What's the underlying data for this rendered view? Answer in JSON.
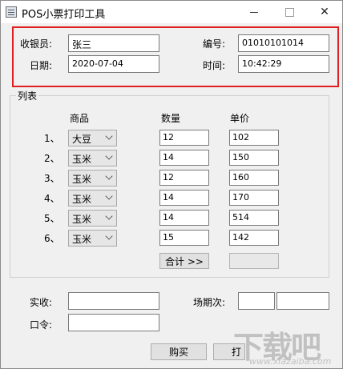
{
  "window": {
    "title": "POS小票打印工具",
    "min_icon": "minimize-icon",
    "max_icon": "maximize-icon",
    "close_glyph": "✕"
  },
  "header": {
    "cashier_label": "收银员:",
    "cashier_value": "张三",
    "number_label": "编号:",
    "number_value": "01010101014",
    "date_label": "日期:",
    "date_value": "2020-07-04",
    "time_label": "时间:",
    "time_value": "10:42:29",
    "highlight_color": "#e02020"
  },
  "list": {
    "group_title": "列表",
    "col_product": "商品",
    "col_qty": "数量",
    "col_price": "单价",
    "rows": [
      {
        "num": "1、",
        "product": "大豆",
        "qty": "12",
        "price": "102"
      },
      {
        "num": "2、",
        "product": "玉米",
        "qty": "14",
        "price": "150"
      },
      {
        "num": "3、",
        "product": "玉米",
        "qty": "12",
        "price": "160"
      },
      {
        "num": "4、",
        "product": "玉米",
        "qty": "14",
        "price": "170"
      },
      {
        "num": "5、",
        "product": "玉米",
        "qty": "14",
        "price": "514"
      },
      {
        "num": "6、",
        "product": "玉米",
        "qty": "15",
        "price": "142"
      }
    ],
    "total_button": "合计 >>",
    "total_value": ""
  },
  "footer": {
    "received_label": "实收:",
    "received_value": "",
    "session_label": "场期次:",
    "session_value_1": "",
    "session_value_2": "",
    "password_label": "口令:",
    "password_value": "",
    "buy_button": "购买",
    "print_button_partial": "打"
  },
  "watermark": {
    "main": "下载吧",
    "url": "www.xiazaiba.com"
  }
}
